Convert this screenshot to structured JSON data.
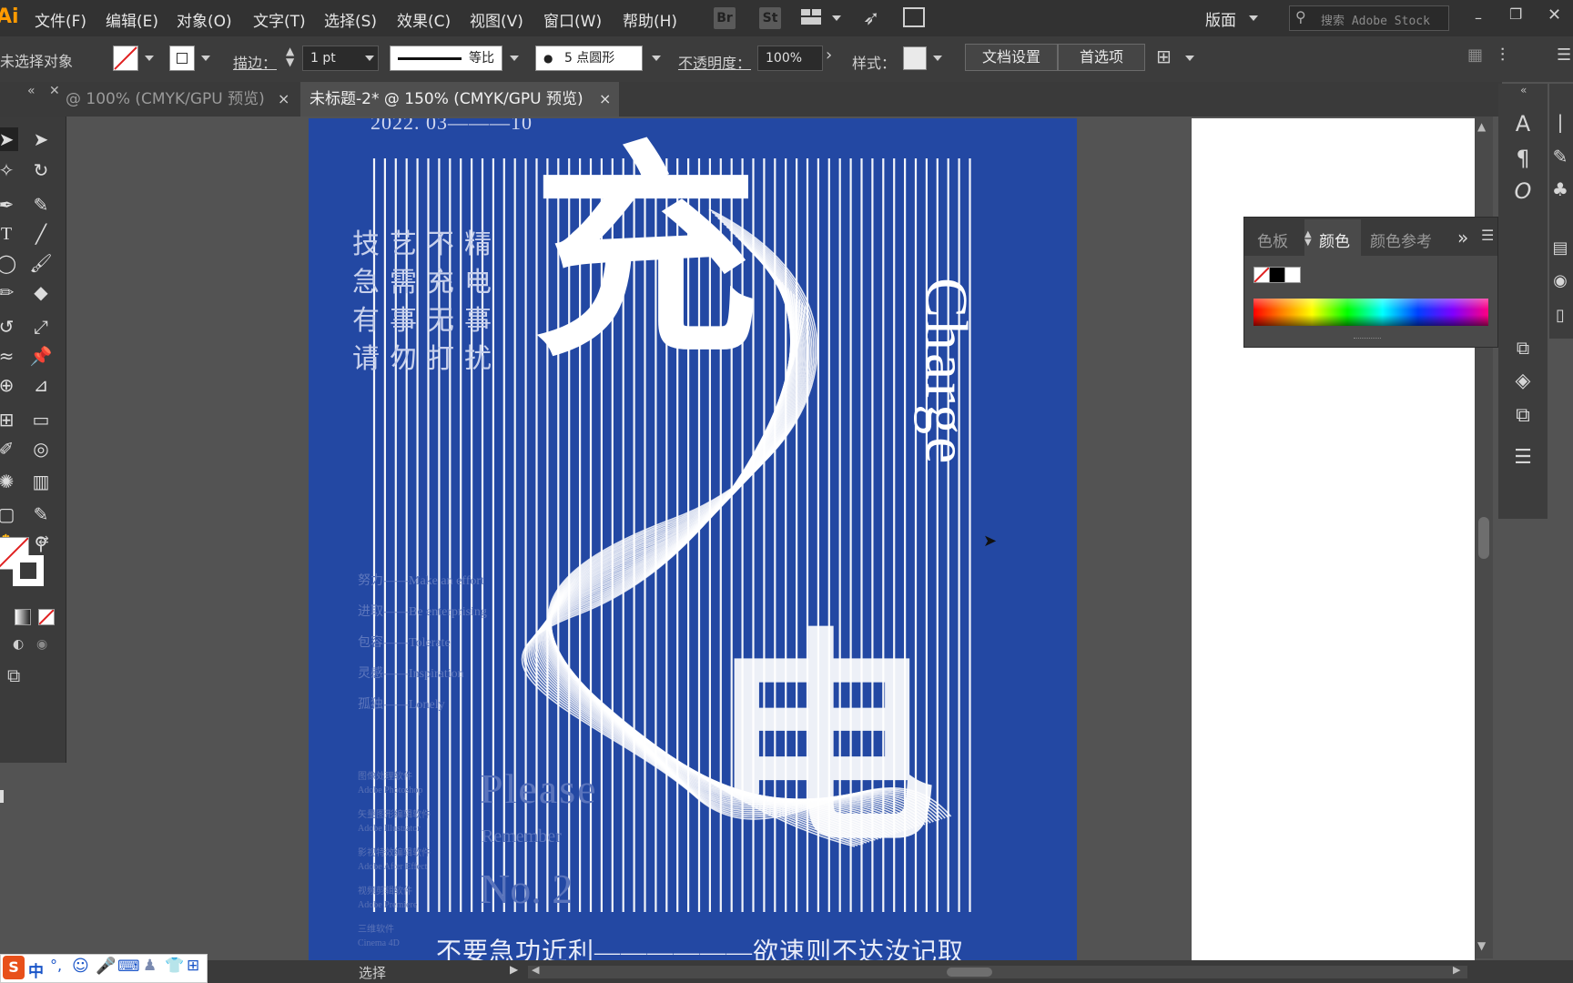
{
  "app": {
    "logo": "Ai"
  },
  "menu": {
    "items": [
      "文件(F)",
      "编辑(E)",
      "对象(O)",
      "文字(T)",
      "选择(S)",
      "效果(C)",
      "视图(V)",
      "窗口(W)",
      "帮助(H)"
    ],
    "bridge": "Br",
    "stock": "St",
    "workspace": "版面",
    "search_placeholder": "搜索 Adobe Stock"
  },
  "control": {
    "selection_status": "未选择对象",
    "stroke_label": "描边：",
    "stroke_value": "1 pt",
    "stroke_profile": "等比",
    "brush": "5 点圆形",
    "opacity_label": "不透明度：",
    "opacity_value": "100%",
    "style_label": "样式：",
    "doc_setup": "文档设置",
    "preferences": "首选项"
  },
  "tabs": [
    {
      "label": "@ 100% (CMYK/GPU 预览)",
      "active": false
    },
    {
      "label": "未标题-2* @ 150% (CMYK/GPU 预览)",
      "active": true
    }
  ],
  "tab_close": "×",
  "artwork": {
    "date": "2022. 03———10",
    "big_char_top": "充",
    "big_char_bottom": "电",
    "vertical_en": "Charge",
    "poem": [
      "技艺不精",
      "急需充电",
      "有事无事",
      "请勿打扰"
    ],
    "values": [
      "努力——Make an effort",
      "进取——Be enterprising",
      "包容——Tolerate",
      "灵感——Inspiration",
      "孤独——Lonely"
    ],
    "software": [
      "图像处理软件",
      "Adobe Photoshop",
      "矢量图形编辑软件",
      "Adobe Illustrator",
      "影视特效编辑软件",
      "Adobe After Effect",
      "视频剪辑软件",
      "Adobe Premiere",
      "三维软件",
      "Cinema 4D"
    ],
    "please": "Please",
    "remember": "Remember",
    "number": "No. 2",
    "bottom_line": "不要急功近利——————欲速则不达汝记取"
  },
  "color_panel": {
    "tabs": [
      "色板",
      "颜色",
      "颜色参考"
    ],
    "active_tab": "颜色",
    "expand": "»"
  },
  "status": {
    "tool": "选择"
  },
  "ime": {
    "mode": "中"
  }
}
